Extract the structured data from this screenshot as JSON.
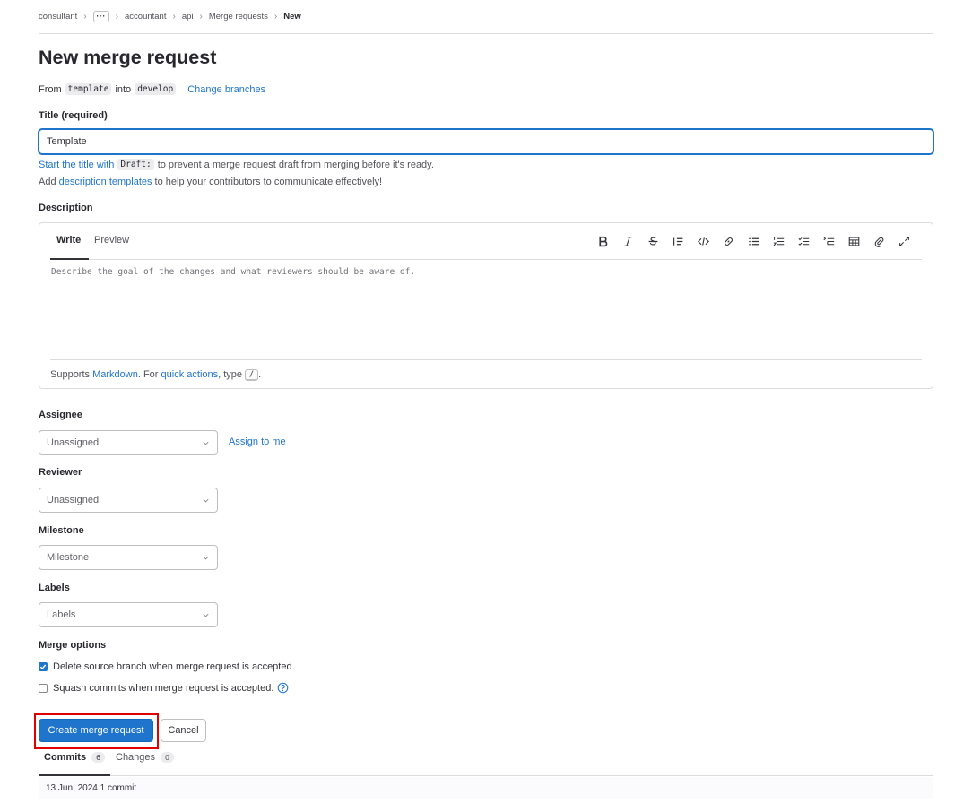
{
  "breadcrumb": [
    {
      "label": "consultant"
    },
    {
      "label": "···",
      "type": "ellipsis"
    },
    {
      "label": "accountant"
    },
    {
      "label": "api"
    },
    {
      "label": "Merge requests"
    },
    {
      "label": "New",
      "current": true
    }
  ],
  "page_title": "New merge request",
  "branches": {
    "from_label": "From",
    "source": "template",
    "into_label": "into",
    "target": "develop",
    "change_link": "Change branches"
  },
  "title_field": {
    "label": "Title (required)",
    "value": "Template",
    "hint_prefix_link": "Start the title with",
    "hint_code": "Draft:",
    "hint_suffix": "to prevent a merge request draft from merging before it's ready.",
    "templates_prefix": "Add",
    "templates_link": "description templates",
    "templates_suffix": "to help your contributors to communicate effectively!"
  },
  "description": {
    "label": "Description",
    "tab_write": "Write",
    "tab_preview": "Preview",
    "placeholder": "Describe the goal of the changes and what reviewers should be aware of.",
    "toolbar_icons": [
      "bold-icon",
      "italic-icon",
      "strikethrough-icon",
      "quote-icon",
      "code-icon",
      "link-icon",
      "bullet-list-icon",
      "numbered-list-icon",
      "task-list-icon",
      "collapsible-section-icon",
      "table-icon",
      "attach-file-icon",
      "fullscreen-icon"
    ],
    "footer_prefix": "Supports",
    "footer_markdown_link": "Markdown",
    "footer_middle": ". For",
    "footer_quick_actions_link": "quick actions",
    "footer_type": ", type",
    "footer_key": "/",
    "footer_end": "."
  },
  "assignee": {
    "label": "Assignee",
    "value": "Unassigned",
    "assign_me": "Assign to me"
  },
  "reviewer": {
    "label": "Reviewer",
    "value": "Unassigned"
  },
  "milestone": {
    "label": "Milestone",
    "value": "Milestone"
  },
  "labels": {
    "label": "Labels",
    "value": "Labels"
  },
  "merge_options": {
    "label": "Merge options",
    "delete_source": {
      "label": "Delete source branch when merge request is accepted.",
      "checked": true
    },
    "squash": {
      "label": "Squash commits when merge request is accepted.",
      "checked": false
    }
  },
  "actions": {
    "create": "Create merge request",
    "cancel": "Cancel"
  },
  "tabs": {
    "commits": {
      "label": "Commits",
      "count": "6"
    },
    "changes": {
      "label": "Changes",
      "count": "0"
    }
  },
  "commit_group": "13 Jun, 2024 1 commit",
  "colors": {
    "accent": "#1f75cb",
    "highlight_border": "#e00000"
  }
}
